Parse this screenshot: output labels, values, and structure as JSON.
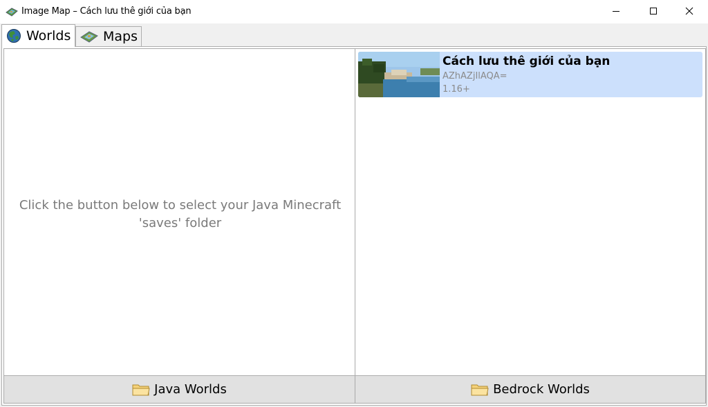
{
  "window": {
    "title": "Image Map – Cách lưu thê giới của bạn",
    "app_icon": "map-icon",
    "controls": [
      "minimize-icon",
      "maximize-icon",
      "close-icon"
    ]
  },
  "tabs": [
    {
      "label": "Worlds",
      "icon": "globe-icon",
      "selected": true
    },
    {
      "label": "Maps",
      "icon": "map-icon",
      "selected": false
    }
  ],
  "java_pane": {
    "placeholder": "Click the button below to select your Java Minecraft 'saves' folder",
    "button_label": "Java Worlds",
    "button_icon": "folder-icon"
  },
  "bedrock_pane": {
    "worlds": [
      {
        "name": "Cách lưu thê giới của bạn",
        "id": "AZhAZjIlAQA=",
        "version": "1.16+",
        "thumbnail": "world-thumbnail"
      }
    ],
    "button_label": "Bedrock Worlds",
    "button_icon": "folder-icon"
  },
  "colors": {
    "selection": "#cce0fc",
    "button_bg": "#e1e1e1",
    "placeholder_text": "#7a7a7a"
  }
}
